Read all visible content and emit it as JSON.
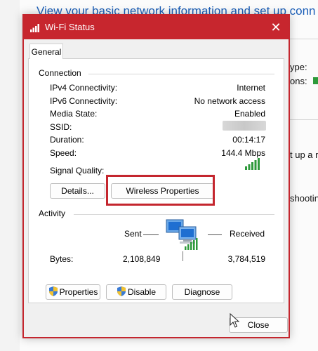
{
  "background": {
    "heading": "View your basic network information and set up conn",
    "snippets": [
      "ype:",
      "ons:",
      "t up a r",
      "shootin"
    ]
  },
  "dialog": {
    "title": "Wi-Fi Status",
    "tab_general": "General",
    "connection": {
      "heading": "Connection",
      "rows": [
        {
          "label": "IPv4 Connectivity:",
          "value": "Internet"
        },
        {
          "label": "IPv6 Connectivity:",
          "value": "No network access"
        },
        {
          "label": "Media State:",
          "value": "Enabled"
        },
        {
          "label": "SSID:",
          "value": ""
        },
        {
          "label": "Duration:",
          "value": "00:14:17"
        },
        {
          "label": "Speed:",
          "value": "144.4 Mbps"
        }
      ],
      "signal_label": "Signal Quality:",
      "signal_bars": 5,
      "details_button": "Details...",
      "wireless_properties_button": "Wireless Properties"
    },
    "activity": {
      "heading": "Activity",
      "sent_label": "Sent",
      "received_label": "Received",
      "bytes_label": "Bytes:",
      "bytes_sent": "2,108,849",
      "bytes_received": "3,784,519"
    },
    "buttons": {
      "properties": "Properties",
      "disable": "Disable",
      "diagnose": "Diagnose",
      "close": "Close"
    },
    "colors": {
      "accent": "#c7262e",
      "signal": "#2e9a3b",
      "link": "#1c5fb8"
    }
  }
}
